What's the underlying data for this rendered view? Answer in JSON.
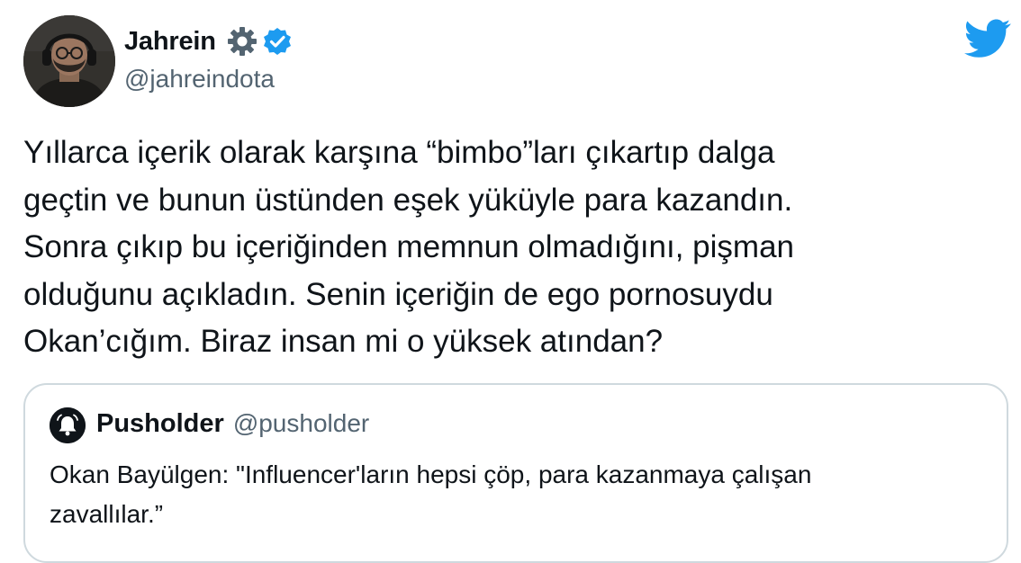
{
  "tweet": {
    "author": {
      "name": "Jahrein",
      "handle": "@jahreindota",
      "badges": [
        "gear-icon",
        "verified-icon"
      ]
    },
    "text_lines": [
      "Yıllarca içerik olarak karşına “bimbo”ları çıkartıp dalga",
      "geçtin ve bunun üstünden eşek yüküyle para kazandın.",
      "Sonra çıkıp bu içeriğinden memnun olmadığını, pişman",
      "olduğunu açıkladın. Senin içeriğin de ego pornosuydu",
      "Okan’cığım. Biraz insan mi o yüksek atından?"
    ],
    "quote": {
      "author_name": "Pusholder",
      "author_handle": "@pusholder",
      "avatar_icon": "bell-icon",
      "text_lines": [
        "Okan Bayülgen: \"Influencer'ların hepsi çöp, para kazanmaya çalışan",
        "zavallılar.”"
      ]
    }
  },
  "brand": {
    "logo": "twitter-bird-icon",
    "colors": {
      "twitter_blue": "#1d9bf0",
      "text_primary": "#0f1419",
      "text_secondary": "#536471",
      "border": "#cfd9de"
    }
  }
}
